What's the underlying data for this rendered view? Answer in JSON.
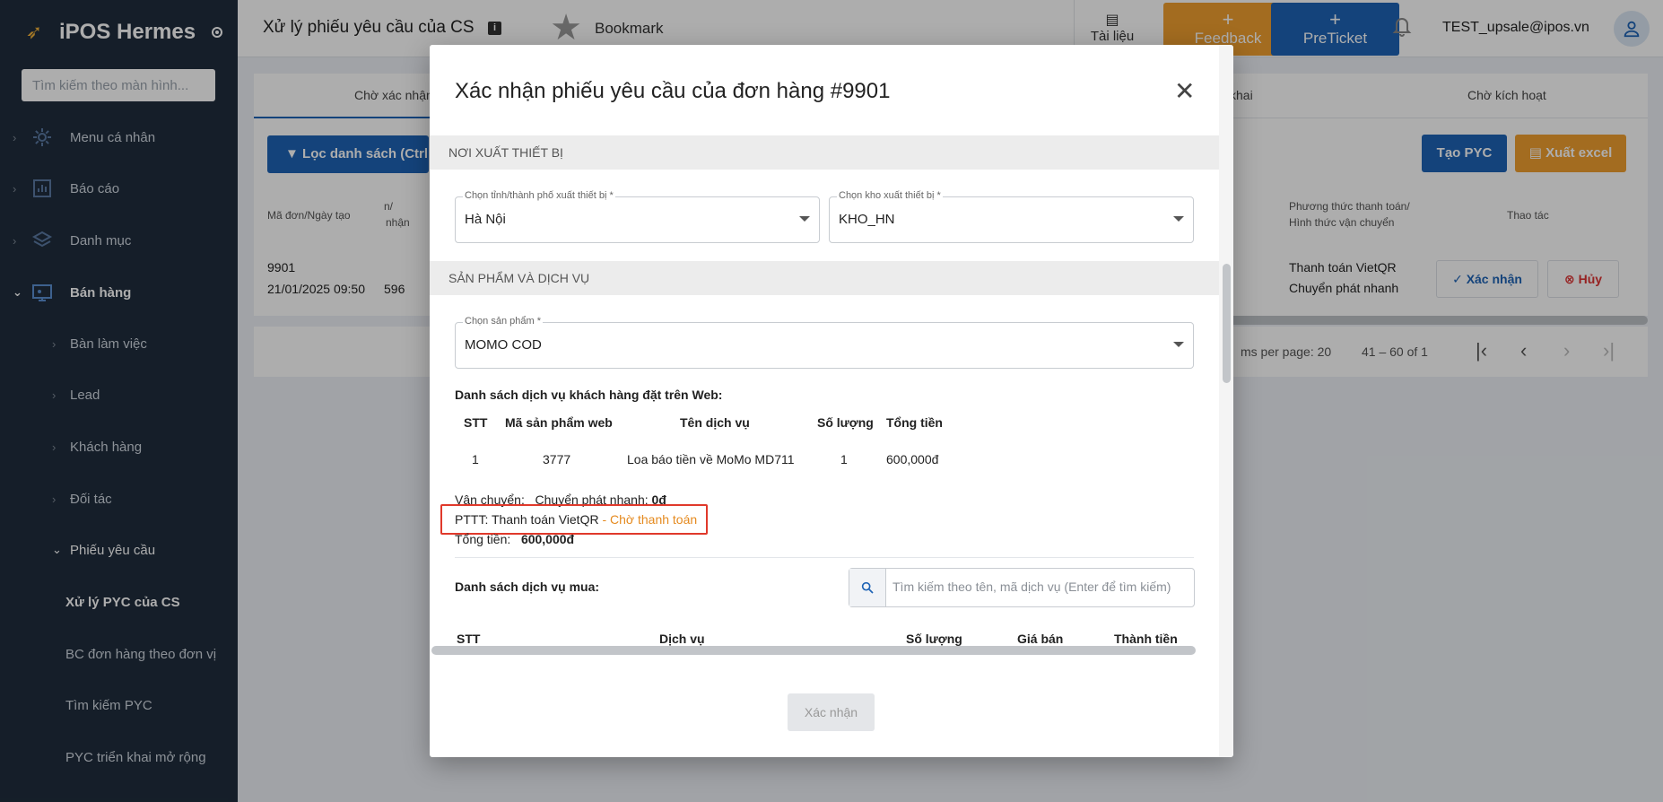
{
  "app": {
    "name": "iPOS Hermes",
    "search_placeholder": "Tìm kiếm theo màn hình..."
  },
  "sidebar": {
    "items": [
      {
        "label": "Menu cá nhân",
        "icon": "gear-icon"
      },
      {
        "label": "Báo cáo",
        "icon": "chart-icon"
      },
      {
        "label": "Danh mục",
        "icon": "layers-icon"
      },
      {
        "label": "Bán hàng",
        "icon": "monitor-icon"
      }
    ],
    "sales_sub": [
      "Bàn làm việc",
      "Lead",
      "Khách hàng",
      "Đối tác",
      "Phiếu yêu cầu"
    ],
    "request_sub": [
      "Xử lý PYC của CS",
      "BC đơn hàng theo đơn vị",
      "Tìm kiếm PYC",
      "PYC triển khai mở rộng"
    ]
  },
  "header": {
    "title": "Xử lý phiếu yêu cầu của CS",
    "bookmark": "Bookmark",
    "docs": "Tài liệu",
    "feedback": "Feedback",
    "preticket": "PreTicket",
    "user_email": "TEST_upsale@ipos.vn"
  },
  "main": {
    "tabs": [
      "Chờ xác nhận",
      "khai",
      "Chờ kích hoạt"
    ],
    "filter_button": "Lọc danh sách (Ctrl + F)",
    "create_button": "Tạo PYC",
    "excel_button": "Xuất excel",
    "columns": {
      "order": "Mã đơn/Ngày tạo",
      "confirm_partial_1": "n/",
      "confirm_partial_2": "nhận",
      "payment_1": "Phương thức thanh toán/",
      "payment_2": "Hình thức vận chuyển",
      "actions": "Thao tác"
    },
    "row": {
      "order_id": "9901",
      "created": "21/01/2025 09:50",
      "code": "596",
      "payment": "Thanh toán VietQR",
      "shipping": "Chuyển phát nhanh",
      "confirm": "Xác nhận",
      "cancel": "Hủy"
    },
    "pager": {
      "per_page": "ms per page: 20",
      "range": "41 – 60 of 1"
    }
  },
  "modal": {
    "title": "Xác nhận phiếu yêu cầu của đơn hàng #9901",
    "section_origin": "NƠI XUẤT THIẾT BỊ",
    "province_label": "Chọn tỉnh/thành phố xuất thiết bị *",
    "province_value": "Hà Nội",
    "warehouse_label": "Chọn kho xuất thiết bị *",
    "warehouse_value": "KHO_HN",
    "section_products": "SẢN PHẨM VÀ DỊCH VỤ",
    "product_label": "Chọn sản phẩm *",
    "product_value": "MOMO COD",
    "web_list_title": "Danh sách dịch vụ khách hàng đặt trên Web:",
    "web_table": {
      "headers": [
        "STT",
        "Mã sản phẩm web",
        "Tên dịch vụ",
        "Số lượng",
        "Tổng tiền"
      ],
      "rows": [
        [
          "1",
          "3777",
          "Loa báo tiền về MoMo MD711",
          "1",
          "600,000đ"
        ]
      ]
    },
    "shipping_label": "Vận chuyển:",
    "shipping_method": "Chuyển phát nhanh:",
    "shipping_fee": "0đ",
    "pttt_label": "PTTT: Thanh toán VietQR",
    "pttt_sep": " - ",
    "pttt_status": "Chờ thanh toán",
    "total_label": "Tổng tiền:",
    "total_value": "600,000đ",
    "buy_list_title": "Danh sách dịch vụ mua:",
    "buy_search_placeholder": "Tìm kiếm theo tên, mã dịch vụ (Enter để tìm kiếm)",
    "buy_headers": [
      "STT",
      "Dịch vụ",
      "Số lượng",
      "Giá bán",
      "Thành tiền"
    ],
    "confirm_button": "Xác nhận"
  },
  "colors": {
    "sidebar_bg": "#1f2d3d",
    "primary": "#1e63b5",
    "accent_orange": "#f0a030",
    "highlight_red": "#e0392b",
    "pending_orange": "#e58a1f"
  }
}
